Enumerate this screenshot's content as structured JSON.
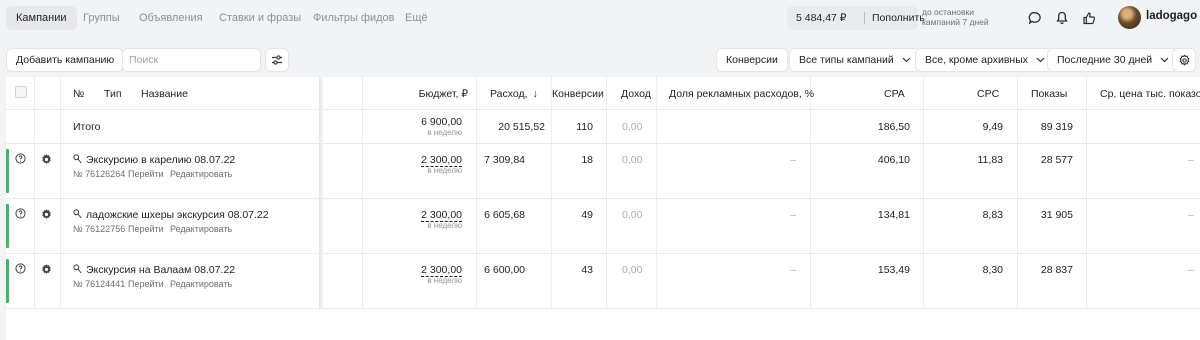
{
  "nav": {
    "tabs": [
      "Кампании",
      "Группы",
      "Объявления",
      "Ставки и фразы",
      "Фильтры фидов",
      "Ещё"
    ],
    "balance": "5 484,47 ₽",
    "topup_label": "Пополнить",
    "stop_note_line1": "до остановки",
    "stop_note_line2": "кампаний 7 дней",
    "username": "ladogago"
  },
  "toolbar": {
    "add_campaign": "Добавить кампанию",
    "search_placeholder": "Поиск",
    "conversions": "Конверсии",
    "campaign_types": "Все типы кампаний",
    "status_filter": "Все, кроме архивных",
    "period": "Последние 30 дней"
  },
  "table": {
    "headers": {
      "num": "№",
      "type": "Тип",
      "name": "Название",
      "budget": "Бюджет, ₽",
      "spend": "Расход,",
      "conversions": "Конверсии",
      "income": "Доход",
      "ad_share": "Доля рекламных расходов, %",
      "cpa": "CPA",
      "cpc": "CPC",
      "impressions": "Показы",
      "avg_price": "Ср. цена тыс. показов"
    },
    "total": {
      "label": "Итого",
      "budget": "6 900,00",
      "budget_period": "в неделю",
      "spend": "20 515,52",
      "conversions": "110",
      "income": "0,00",
      "cpa": "186,50",
      "cpc": "9,49",
      "impressions": "89 319"
    },
    "rows": [
      {
        "name": "Экскурсию в карелию  08.07.22",
        "id": "№ 76126264",
        "go": "Перейти",
        "edit": "Редактировать",
        "budget": "2 300,00",
        "budget_period": "в неделю",
        "spend": "7 309,84",
        "conversions": "18",
        "income": "0,00",
        "ad_share": "–",
        "cpa": "406,10",
        "cpc": "11,83",
        "impressions": "28 577",
        "avg_price": "–"
      },
      {
        "name": "ладожские шхеры экскурсия 08.07.22",
        "id": "№ 76122756",
        "go": "Перейти",
        "edit": "Редактировать",
        "budget": "2 300,00",
        "budget_period": "в неделю",
        "spend": "6 605,68",
        "conversions": "49",
        "income": "0,00",
        "ad_share": "–",
        "cpa": "134,81",
        "cpc": "8,83",
        "impressions": "31 905",
        "avg_price": "–"
      },
      {
        "name": "Экскурсия на Валаам 08.07.22",
        "id": "№ 76124441",
        "go": "Перейти",
        "edit": "Редактировать",
        "budget": "2 300,00",
        "budget_period": "в неделю",
        "spend": "6 600,00",
        "conversions": "43",
        "income": "0,00",
        "ad_share": "–",
        "cpa": "153,49",
        "cpc": "8,30",
        "impressions": "28 837",
        "avg_price": "–"
      }
    ]
  },
  "colors": {
    "status_active": "#3dba5c",
    "page_bg": "#f2f3f5"
  }
}
